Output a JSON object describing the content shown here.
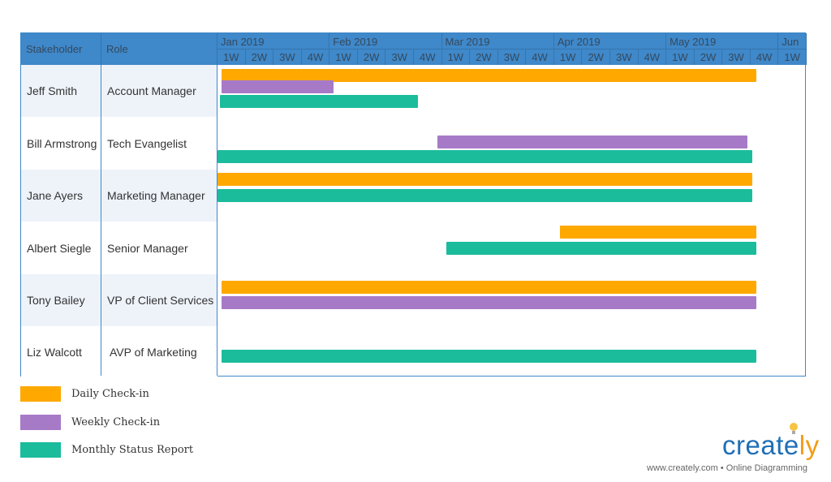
{
  "colors": {
    "daily": "#ffa800",
    "weekly": "#a77ac7",
    "monthly": "#1abc9c",
    "header": "#3f88c9",
    "row_alt": "#eef3fa"
  },
  "headers": {
    "stakeholder": "Stakeholder",
    "role": "Role"
  },
  "months": [
    {
      "label": "Jan 2019",
      "weeks": [
        "1W",
        "2W",
        "3W",
        "4W"
      ]
    },
    {
      "label": "Feb 2019",
      "weeks": [
        "1W",
        "2W",
        "3W",
        "4W"
      ]
    },
    {
      "label": "Mar 2019",
      "weeks": [
        "1W",
        "2W",
        "3W",
        "4W"
      ]
    },
    {
      "label": "Apr 2019",
      "weeks": [
        "1W",
        "2W",
        "3W",
        "4W"
      ]
    },
    {
      "label": "May 2019",
      "weeks": [
        "1W",
        "2W",
        "3W",
        "4W"
      ]
    },
    {
      "label": "Jun",
      "weeks": [
        "1W"
      ]
    }
  ],
  "rows": [
    {
      "name": "Jeff Smith",
      "role": "Account Manager",
      "bars": [
        {
          "type": "daily",
          "start": 0.15,
          "end": 19.2
        },
        {
          "type": "weekly",
          "start": 0.15,
          "end": 4.15
        },
        {
          "type": "monthly",
          "start": 0.1,
          "end": 7.15
        }
      ]
    },
    {
      "name": "Bill Armstrong",
      "role": "Tech Evangelist",
      "bars": [
        {
          "type": "weekly",
          "start": 7.85,
          "end": 18.9
        },
        {
          "type": "monthly",
          "start": 0,
          "end": 19.05
        }
      ]
    },
    {
      "name": "Jane Ayers",
      "role": "Marketing Manager",
      "bars": [
        {
          "type": "daily",
          "start": 0,
          "end": 19.05
        },
        {
          "type": "monthly",
          "start": 0,
          "end": 19.05
        }
      ]
    },
    {
      "name": "Albert Siegle",
      "role": "Senior Manager",
      "bars": [
        {
          "type": "daily",
          "start": 12.2,
          "end": 19.2
        },
        {
          "type": "monthly",
          "start": 8.15,
          "end": 19.2
        }
      ]
    },
    {
      "name": "Tony Bailey",
      "role": "VP of Client Services",
      "bars": [
        {
          "type": "daily",
          "start": 0.15,
          "end": 19.2
        },
        {
          "type": "weekly",
          "start": 0.15,
          "end": 19.2
        }
      ]
    },
    {
      "name": "Liz Walcott",
      "role": "AVP of Marketing",
      "bars": [
        {
          "type": "monthly",
          "start": 0.15,
          "end": 19.2
        }
      ]
    }
  ],
  "legend": [
    {
      "type": "daily",
      "label": "Daily Check-in"
    },
    {
      "type": "weekly",
      "label": "Weekly Check-in"
    },
    {
      "type": "monthly",
      "label": "Monthly Status Report"
    }
  ],
  "brand": {
    "logo": "creately",
    "tagline": "www.creately.com • Online Diagramming"
  }
}
